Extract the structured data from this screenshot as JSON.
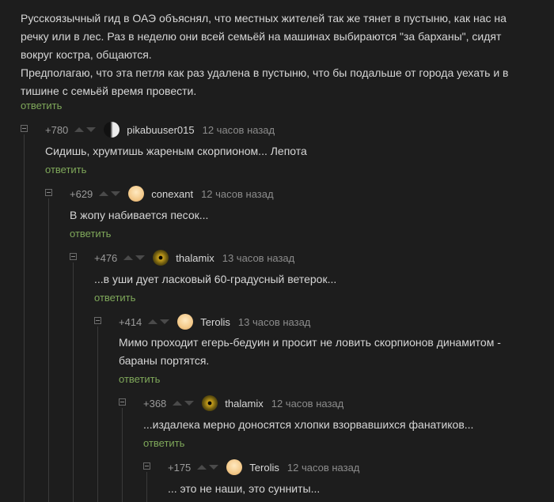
{
  "top_comment": {
    "paragraph_1": "Русскоязычный гид в ОАЭ объяснял, что местных жителей так же тянет в пустыню, как нас на речку или в лес. Раз в неделю они всей семьёй на машинах выбираются \"за барханы\", сидят вокруг костра, общаются.",
    "paragraph_2": "Предполагаю, что эта петля как раз удалена в пустыню, что бы подальше от города уехать и в тишине с семьёй время провести.",
    "reply_label": "ответить"
  },
  "comments": [
    {
      "rating": "+780",
      "author": "pikabuuser015",
      "time": "12 часов назад",
      "text": "Сидишь, хрумтишь жареным скорпионом... Лепота",
      "reply_label": "ответить",
      "avatar": "pikabu-logo-avatar"
    },
    {
      "rating": "+629",
      "author": "conexant",
      "time": "12 часов назад",
      "text": "В жопу набивается песок...",
      "reply_label": "ответить",
      "avatar": "cream-circle-avatar"
    },
    {
      "rating": "+476",
      "author": "thalamix",
      "time": "13 часов назад",
      "text": "...в уши дует ласковый 60-градусный ветерок...",
      "reply_label": "ответить",
      "avatar": "eye-avatar"
    },
    {
      "rating": "+414",
      "author": "Terolis",
      "time": "13 часов назад",
      "text": "Мимо проходит егерь-бедуин и просит не ловить скорпионов динамитом - бараны портятся.",
      "reply_label": "ответить",
      "avatar": "cream-circle-avatar"
    },
    {
      "rating": "+368",
      "author": "thalamix",
      "time": "12 часов назад",
      "text": "...издалека мерно доносятся хлопки взорвавшихся фанатиков...",
      "reply_label": "ответить",
      "avatar": "eye-avatar"
    },
    {
      "rating": "+175",
      "author": "Terolis",
      "time": "12 часов назад",
      "text": "... это не наши, это сунниты...",
      "reply_label": "",
      "avatar": "cream-circle-avatar"
    }
  ],
  "colors": {
    "background": "#1d1d1d",
    "text": "#d6d6d6",
    "reply_link": "#7fa85a",
    "meta": "#8c8c8c"
  }
}
